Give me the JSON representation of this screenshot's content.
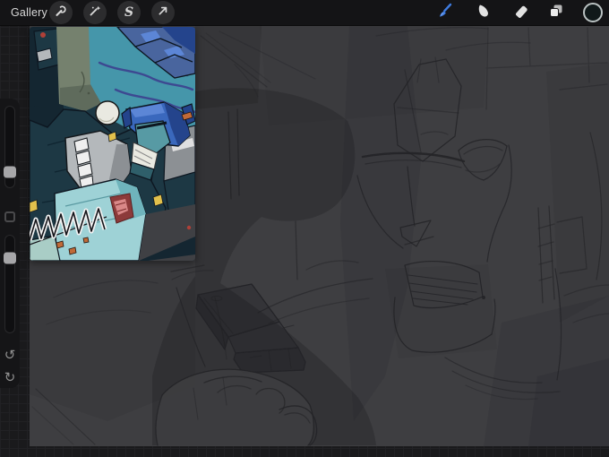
{
  "top_bar": {
    "gallery_label": "Gallery",
    "selection_letter": "S",
    "left_tools": [
      {
        "name": "actions",
        "icon": "wrench-icon"
      },
      {
        "name": "adjustments",
        "icon": "magic-wand-icon"
      },
      {
        "name": "selection",
        "icon": "s-ribbon-icon"
      },
      {
        "name": "transform",
        "icon": "arrow-cursor-icon"
      }
    ],
    "right_tools": [
      {
        "name": "paint",
        "icon": "brush-icon",
        "active": true
      },
      {
        "name": "smudge",
        "icon": "smudge-finger-icon",
        "active": false
      },
      {
        "name": "erase",
        "icon": "eraser-icon",
        "active": false
      },
      {
        "name": "layers",
        "icon": "layers-icon",
        "active": false
      },
      {
        "name": "color",
        "icon": "color-swatch-circle",
        "active": false
      }
    ]
  },
  "sidebar": {
    "brush_size_slider_pos_pct": 81,
    "opacity_slider_pos_pct": 23,
    "undo_icon": "↺",
    "redo_icon": "↻"
  },
  "canvas": {
    "description": "dark gray canvas with rough pencil sketch: large frowning robot face on right, fist gripping a blaster at center bottom, soft cast-shadow silhouette across left",
    "reference_overlay": "color comic panel reference: blue armored robot aiming a blaster over teal water, gray wall, white sphere, red autobot insignia, white recoil spring"
  },
  "colors": {
    "topbar_bg": "#141416",
    "topbar_btn_bg": "#2c2c2e",
    "chrome_icon": "#d8d8d8",
    "gallery_text": "#d9d9d9",
    "accent_blue": "#3f7ce0",
    "accent_blue_light": "#7aa5ec",
    "outside_bg": "#1a1a1c",
    "grid_line": "#212124",
    "canvas_bg": "#3e3e41",
    "sketch_line": "#232327",
    "sidebar_bg": "#151517",
    "slider_track": "#0f0f11",
    "slider_track_border": "#29292b",
    "slider_handle": "#a6a6a8",
    "undo_icon_color": "#8f8f8f",
    "swatch_fill": "#10191a",
    "swatch_ring": "#b9c1c1",
    "ref_navy": "#1d3844",
    "ref_navy_dark": "#142631",
    "ref_navy_deep": "#0d1620",
    "ref_teal_bg": "#4596aa",
    "ref_wave": "#3c3c8e",
    "ref_wall": "#75816e",
    "ref_wall_dark": "#5f6b5c",
    "ref_blue_helmet": "#3a68bd",
    "ref_blue_dark": "#24448c",
    "ref_blue_light": "#5c86d6",
    "ref_face_teal": "#579aa4",
    "ref_teal_dark": "#2f5f6a",
    "ref_white": "#e9e9e1",
    "ref_gray": "#b4b8bb",
    "ref_gray_dark": "#8c9094",
    "ref_chest": "#9ed2d6",
    "ref_chest_dark": "#6fb4bc",
    "ref_red": "#b04038",
    "ref_red_light": "#d98888",
    "ref_yellow": "#e2c04c",
    "ref_orange": "#c06a38",
    "ref_bottom_gray": "#3f4044",
    "ref_foot_blue": "#49659e"
  }
}
